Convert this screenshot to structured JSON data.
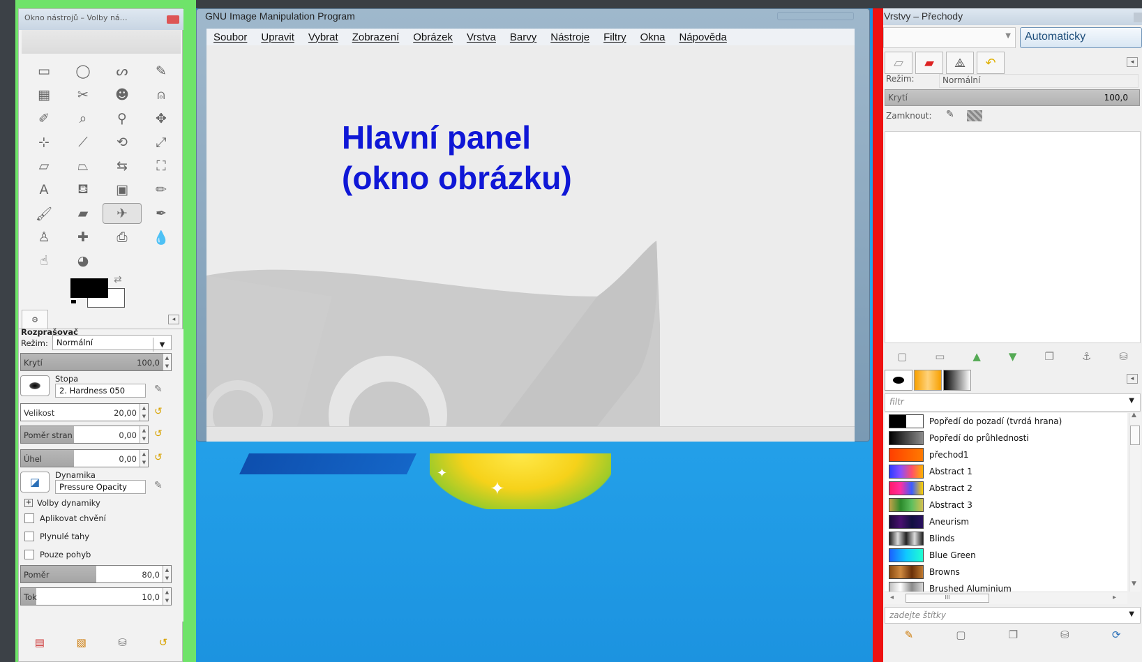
{
  "desktop": {
    "sparkle_glyph": "✦"
  },
  "toolbox": {
    "title": "Okno nástrojů – Volby ná…",
    "tools": [
      {
        "icon": "rect-select-icon",
        "glyph": "▭"
      },
      {
        "icon": "ellipse-select-icon",
        "glyph": "◯"
      },
      {
        "icon": "free-select-icon",
        "glyph": "ᔕ"
      },
      {
        "icon": "fuzzy-select-icon",
        "glyph": "✎"
      },
      {
        "icon": "color-select-icon",
        "glyph": "▦"
      },
      {
        "icon": "scissors-icon",
        "glyph": "✂"
      },
      {
        "icon": "foreground-select-icon",
        "glyph": "☻"
      },
      {
        "icon": "paths-icon",
        "glyph": "⍝"
      },
      {
        "icon": "color-picker-icon",
        "glyph": "✐"
      },
      {
        "icon": "zoom-icon",
        "glyph": "⌕"
      },
      {
        "icon": "measure-icon",
        "glyph": "⚲"
      },
      {
        "icon": "move-icon",
        "glyph": "✥"
      },
      {
        "icon": "align-icon",
        "glyph": "⊹"
      },
      {
        "icon": "crop-icon",
        "glyph": "⟋"
      },
      {
        "icon": "rotate-icon",
        "glyph": "⟲"
      },
      {
        "icon": "scale-icon",
        "glyph": "⤢"
      },
      {
        "icon": "shear-icon",
        "glyph": "▱"
      },
      {
        "icon": "perspective-icon",
        "glyph": "⏢"
      },
      {
        "icon": "flip-icon",
        "glyph": "⇆"
      },
      {
        "icon": "cage-icon",
        "glyph": "⛶"
      },
      {
        "icon": "text-icon",
        "glyph": "A"
      },
      {
        "icon": "bucket-fill-icon",
        "glyph": "⛾"
      },
      {
        "icon": "blend-icon",
        "glyph": "▣"
      },
      {
        "icon": "pencil-icon",
        "glyph": "✏"
      },
      {
        "icon": "paintbrush-icon",
        "glyph": "🖌"
      },
      {
        "icon": "eraser-icon",
        "glyph": "▰"
      },
      {
        "icon": "airbrush-icon",
        "glyph": "✈"
      },
      {
        "icon": "ink-icon",
        "glyph": "✒"
      },
      {
        "icon": "clone-icon",
        "glyph": "♙"
      },
      {
        "icon": "heal-icon",
        "glyph": "✚"
      },
      {
        "icon": "perspective-clone-icon",
        "glyph": "⎙"
      },
      {
        "icon": "blur-icon",
        "glyph": "💧"
      },
      {
        "icon": "smudge-icon",
        "glyph": "☝"
      },
      {
        "icon": "dodge-burn-icon",
        "glyph": "◕"
      }
    ],
    "active_tool_index": 26,
    "options": {
      "tool_name": "Rozprašovač",
      "mode_label": "Režim:",
      "mode_value": "Normální",
      "opacity": {
        "label": "Krytí",
        "value": "100,0",
        "fraction": 1.0
      },
      "brush_label": "Stopa",
      "brush_value": "2. Hardness 050",
      "size": {
        "label": "Velikost",
        "value": "20,00",
        "fraction": 0.0
      },
      "aspect": {
        "label": "Poměr stran",
        "value": "0,00",
        "fraction": 0.42
      },
      "angle": {
        "label": "Úhel",
        "value": "0,00",
        "fraction": 0.42
      },
      "dynamics_label": "Dynamika",
      "dynamics_value": "Pressure Opacity",
      "dynamics_options_label": "Volby dynamiky",
      "jitter_label": "Aplikovat chvění",
      "smooth_label": "Plynulé tahy",
      "motion_label": "Pouze pohyb",
      "rate": {
        "label": "Poměr",
        "value": "80,0",
        "fraction": 0.5
      },
      "flow": {
        "label": "Tok",
        "value": "10,0",
        "fraction": 0.1
      }
    }
  },
  "image_window": {
    "title": "GNU Image Manipulation Program",
    "menus": [
      "Soubor",
      "Upravit",
      "Vybrat",
      "Zobrazení",
      "Obrázek",
      "Vrstva",
      "Barvy",
      "Nástroje",
      "Filtry",
      "Okna",
      "Nápověda"
    ],
    "annotation_line1": "Hlavní panel",
    "annotation_line2": "(okno obrázku)"
  },
  "dock": {
    "title": "Vrstvy – Přechody",
    "auto_button": "Automaticky",
    "mode_label": "Režim:",
    "mode_value": "Normální",
    "opacity_label": "Krytí",
    "opacity_value": "100,0",
    "lock_label": "Zamknout:",
    "filter_placeholder": "filtr",
    "tags_placeholder": "zadejte štítky",
    "hscroll_grip": "III",
    "gradients": [
      {
        "name": "Popředí do pozadí (tvrdá hrana)",
        "colors": [
          "#000000",
          "#000000",
          "#ffffff",
          "#ffffff"
        ],
        "hard": true
      },
      {
        "name": "Popředí do průhlednosti",
        "colors": [
          "#000000",
          "#8a8a8a"
        ]
      },
      {
        "name": "přechod1",
        "colors": [
          "#ff3f00",
          "#ff7a00"
        ]
      },
      {
        "name": "Abstract 1",
        "colors": [
          "#2d3cff",
          "#8a4fff",
          "#ff4f6a",
          "#ffb000"
        ]
      },
      {
        "name": "Abstract 2",
        "colors": [
          "#ff1a6a",
          "#ff2fa0",
          "#3a5cff",
          "#ffd000"
        ]
      },
      {
        "name": "Abstract 3",
        "colors": [
          "#c4a24a",
          "#2b8a2b",
          "#5fbf5f",
          "#d2c050"
        ]
      },
      {
        "name": "Aneurism",
        "colors": [
          "#1a0a3a",
          "#4a1070",
          "#101040",
          "#2a1060"
        ]
      },
      {
        "name": "Blinds",
        "colors": [
          "#222222",
          "#dddddd",
          "#222222",
          "#dddddd",
          "#222222"
        ]
      },
      {
        "name": "Blue Green",
        "colors": [
          "#1a60ff",
          "#10c8ff",
          "#20ffd0"
        ]
      },
      {
        "name": "Browns",
        "colors": [
          "#8a4a10",
          "#d08a40",
          "#6a3008",
          "#c07a30"
        ]
      },
      {
        "name": "Brushed Aluminium",
        "colors": [
          "#c0c0c0",
          "#ffffff",
          "#8a8a8a",
          "#d8d8d8"
        ]
      }
    ]
  }
}
